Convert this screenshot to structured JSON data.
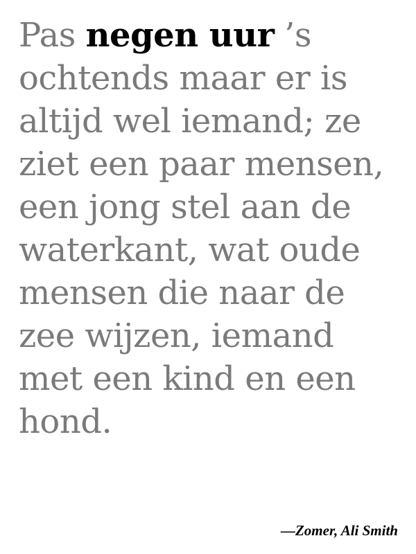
{
  "quote": {
    "line1_before": "Pas ",
    "line1_emphasis": "negen uur",
    "line1_after": " ’s",
    "lines": [
      "ochtends maar er is",
      "altijd wel iemand; ze",
      "ziet een paar mensen,",
      "een jong stel aan de",
      "waterkant, wat oude",
      "mensen die naar de",
      "zee wijzen, iemand",
      "met een kind en een",
      "hond."
    ]
  },
  "attribution": "—Zomer, Ali Smith",
  "colors": {
    "text_muted": "#7a7a7a",
    "text_emphasis": "#000000",
    "background": "#ffffff"
  }
}
